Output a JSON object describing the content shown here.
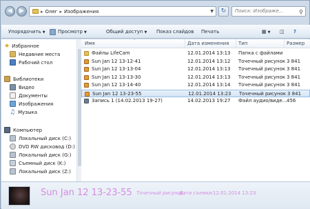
{
  "address": {
    "crumbs": [
      "Олег",
      "Изображения"
    ]
  },
  "search": {
    "placeholder": "Поиск: Изображе..."
  },
  "toolbar": {
    "organize": "Упорядочить",
    "view": "Просмотр",
    "share": "Общий доступ",
    "slideshow": "Показ слайдов",
    "print": "Печать"
  },
  "sidebar": {
    "favorites": {
      "label": "Избранное",
      "items": [
        "Недавние места",
        "Рабочий стол"
      ]
    },
    "libraries": {
      "label": "Библиотеки",
      "items": [
        "Видео",
        "Документы",
        "Изображения",
        "Музыка"
      ]
    },
    "computer": {
      "label": "Компьютер",
      "items": [
        "Локальный диск (C:)",
        "DVD RW дисковод (D:) I",
        "Локальный диск (G:)",
        "Съемный диск (K:)",
        "Локальный диск (Z:)"
      ]
    }
  },
  "columns": {
    "name": "Имя",
    "date": "Дата изменения",
    "type": "Тип",
    "size": "Размер"
  },
  "files": [
    {
      "name": "Файлы LifeCam",
      "date": "12.01.2014 13:13",
      "type": "Папка с файлами",
      "size": "",
      "icon": "folder-icon",
      "selected": false
    },
    {
      "name": "Sun Jan 12 13-12-41",
      "date": "12.01.2014 13:12",
      "type": "Точечный рисунок",
      "size": "3 841",
      "icon": "image-icon",
      "selected": false
    },
    {
      "name": "Sun Jan 12 13-13-04",
      "date": "12.01.2014 13:13",
      "type": "Точечный рисунок",
      "size": "3 841",
      "icon": "image-icon",
      "selected": false
    },
    {
      "name": "Sun Jan 12 13-13-30",
      "date": "12.01.2014 13:13",
      "type": "Точечный рисунок",
      "size": "3 841",
      "icon": "image-icon",
      "selected": false
    },
    {
      "name": "Sun Jan 12 13-14-40",
      "date": "12.01.2014 13:14",
      "type": "Точечный рисунок",
      "size": "3 841",
      "icon": "image-icon",
      "selected": false
    },
    {
      "name": "Sun Jan 12 13-23-55",
      "date": "12.01.2014 13:23",
      "type": "Точечный рисунок",
      "size": "3 841",
      "icon": "image-icon",
      "selected": true
    },
    {
      "name": "Запись 1 (14.02.2013 19-27)",
      "date": "14.02.2013 19:27",
      "type": "Файл аудио/виде...",
      "size": "456",
      "icon": "media-icon",
      "selected": false
    }
  ],
  "details": {
    "name": "Sun Jan 12 13-23-55",
    "type": "Точечный рисунок",
    "date_label": "Дата съемки:",
    "date_value": "12.01.2014 13:23"
  },
  "colors": {
    "accent": "#98bce3",
    "details_text": "#d48de0",
    "folder": "#e6c15a"
  }
}
